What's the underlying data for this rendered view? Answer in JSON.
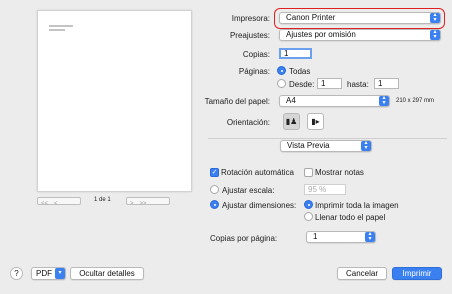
{
  "preview": {
    "page_indicator": "1 de 1",
    "first": "<<",
    "prev": "<",
    "next": ">",
    "last": ">>"
  },
  "printer": {
    "label": "Impresora:",
    "value": "Canon Printer"
  },
  "presets": {
    "label": "Preajustes:",
    "value": "Ajustes por omisión"
  },
  "copies": {
    "label": "Copias:",
    "value": "1"
  },
  "pages": {
    "label": "Páginas:",
    "all": "Todas",
    "from": "Desde:",
    "from_value": "1",
    "to": "hasta:",
    "to_value": "1"
  },
  "paper_size": {
    "label": "Tamaño del papel:",
    "value": "A4",
    "dimensions": "210 x 297 mm"
  },
  "orientation": {
    "label": "Orientación:"
  },
  "section_popup": {
    "value": "Vista Previa"
  },
  "options": {
    "auto_rotate": "Rotación automática",
    "show_notes": "Mostrar notas",
    "scale": "Ajustar escala:",
    "scale_value": "95 %",
    "fit_size": "Ajustar dimensiones:",
    "print_entire": "Imprimir toda la imagen",
    "fill_paper": "Llenar todo el papel",
    "copies_per_page_label": "Copias por página:",
    "copies_per_page_value": "1"
  },
  "footer": {
    "help": "?",
    "pdf": "PDF",
    "hide_details": "Ocultar detalles",
    "cancel": "Cancelar",
    "print": "Imprimir"
  },
  "colors": {
    "accent": "#3b80f0",
    "highlight_ring": "#e02020"
  }
}
